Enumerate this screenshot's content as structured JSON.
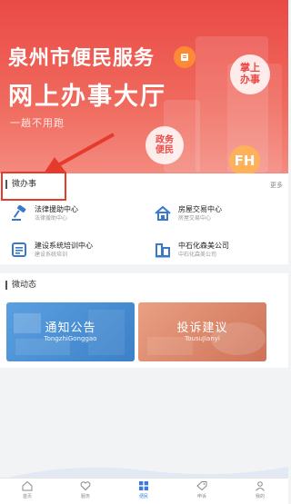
{
  "banner": {
    "title_line1": "泉州市便民服务",
    "title_line2": "网上办事大厅",
    "slogan": "一趟不用跑",
    "bubble_handheld": "掌上\n办事",
    "bubble_gov": "政务\n便民",
    "bubble_fh": "FH"
  },
  "micro_service": {
    "title": "微办事",
    "more": "更多",
    "items": [
      {
        "title": "法律援助中心",
        "sub": "法律援助中心",
        "icon": "gavel-icon"
      },
      {
        "title": "房屋交易中心",
        "sub": "房屋交易中心",
        "icon": "house-icon"
      },
      {
        "title": "建设系统培训中心",
        "sub": "建设系统培训",
        "icon": "training-icon"
      },
      {
        "title": "中石化森美公司",
        "sub": "中石化森美公司",
        "icon": "building-icon"
      }
    ]
  },
  "micro_news": {
    "title": "微动态",
    "cards": [
      {
        "title": "通知公告",
        "sub": "TongzhiGonggao",
        "color": "#4a8fd4"
      },
      {
        "title": "投诉建议",
        "sub": "TousuJianyi",
        "color": "#e0896a"
      }
    ]
  },
  "tabbar": {
    "items": [
      {
        "label": "首页",
        "icon": "home-icon"
      },
      {
        "label": "服务",
        "icon": "heart-icon"
      },
      {
        "label": "便民",
        "icon": "grid-icon",
        "active": true
      },
      {
        "label": "申诉",
        "icon": "tag-icon"
      },
      {
        "label": "我的",
        "icon": "user-icon"
      }
    ]
  },
  "colors": {
    "accent_red": "#ea4a46",
    "tab_active": "#3b7ae0"
  }
}
